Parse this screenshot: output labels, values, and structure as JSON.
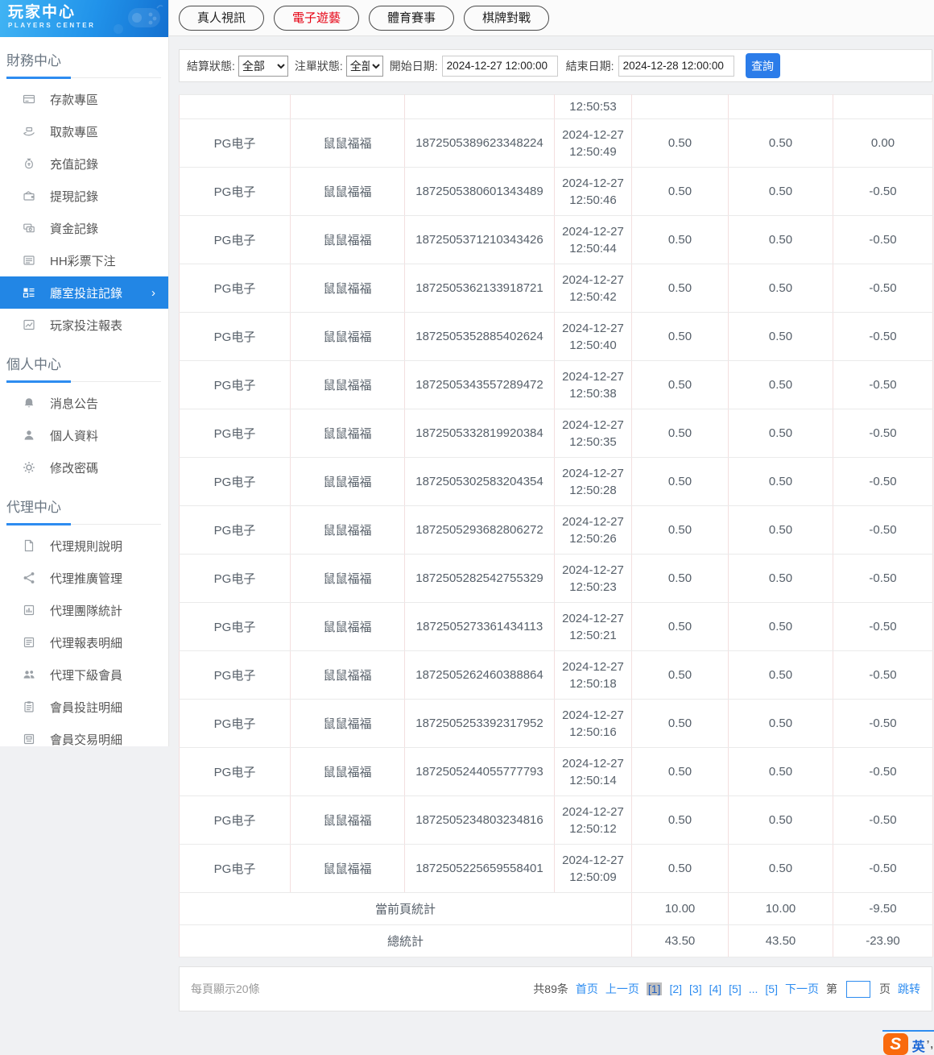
{
  "sidebar": {
    "logo": {
      "title": "玩家中心",
      "subtitle": "PLAYERS CENTER"
    },
    "sections": [
      {
        "title": "財務中心",
        "items": [
          {
            "slug": "deposit-area",
            "icon": "deposit-icon",
            "label": "存款專區"
          },
          {
            "slug": "withdraw-area",
            "icon": "withdraw-icon",
            "label": "取款專區"
          },
          {
            "slug": "recharge-records",
            "icon": "recharge-icon",
            "label": "充值記錄"
          },
          {
            "slug": "withdrawal-records",
            "icon": "wallet-icon",
            "label": "提現記錄"
          },
          {
            "slug": "funds-records",
            "icon": "funds-icon",
            "label": "資金記錄"
          },
          {
            "slug": "hh-lottery-bets",
            "icon": "lottery-icon",
            "label": "HH彩票下注"
          },
          {
            "slug": "room-bet-records",
            "icon": "room-bets-icon",
            "label": "廳室投註記錄",
            "active": true,
            "chevron": "›"
          },
          {
            "slug": "player-bet-report",
            "icon": "chart-icon",
            "label": "玩家投注報表"
          }
        ]
      },
      {
        "title": "個人中心",
        "items": [
          {
            "slug": "announcements",
            "icon": "bell-icon",
            "label": "消息公告"
          },
          {
            "slug": "profile",
            "icon": "person-icon",
            "label": "個人資料"
          },
          {
            "slug": "change-password",
            "icon": "gear-icon",
            "label": "修改密碼"
          }
        ]
      },
      {
        "title": "代理中心",
        "items": [
          {
            "slug": "agent-rules",
            "icon": "doc-icon",
            "label": "代理規則說明"
          },
          {
            "slug": "agent-promotion",
            "icon": "share-icon",
            "label": "代理推廣管理"
          },
          {
            "slug": "agent-team-stats",
            "icon": "team-stats-icon",
            "label": "代理團隊統計"
          },
          {
            "slug": "agent-report-detail",
            "icon": "report-detail-icon",
            "label": "代理報表明細"
          },
          {
            "slug": "agent-sub-members",
            "icon": "users-icon",
            "label": "代理下級會員"
          },
          {
            "slug": "member-bet-detail",
            "icon": "clipboard-icon",
            "label": "會員投註明細"
          },
          {
            "slug": "member-transaction-detail",
            "icon": "ledger-icon",
            "label": "會員交易明細"
          }
        ]
      }
    ]
  },
  "tabs": [
    {
      "slug": "live-video",
      "label": "真人視訊",
      "active": false
    },
    {
      "slug": "electronic-games",
      "label": "電子遊藝",
      "active": true
    },
    {
      "slug": "sports",
      "label": "體育賽事",
      "active": false
    },
    {
      "slug": "board-games",
      "label": "棋牌對戰",
      "active": false
    }
  ],
  "filters": {
    "settle_status_label": "結算狀態:",
    "settle_status_value": "全部",
    "order_status_label": "注單狀態:",
    "order_status_value": "全部",
    "start_date_label": "開始日期:",
    "start_date_value": "2024-12-27 12:00:00",
    "end_date_label": "結束日期:",
    "end_date_value": "2024-12-28 12:00:00",
    "search_button": "查詢"
  },
  "table": {
    "rows": [
      {
        "partial": true,
        "platform": "",
        "player": "",
        "order": "",
        "date": "",
        "time": "12:50:53",
        "bet": "",
        "valid": "",
        "profit": ""
      },
      {
        "platform": "PG电子",
        "player": "鼠鼠福福",
        "order": "1872505389623348224",
        "date": "2024-12-27",
        "time": "12:50:49",
        "bet": "0.50",
        "valid": "0.50",
        "profit": "0.00"
      },
      {
        "platform": "PG电子",
        "player": "鼠鼠福福",
        "order": "1872505380601343489",
        "date": "2024-12-27",
        "time": "12:50:46",
        "bet": "0.50",
        "valid": "0.50",
        "profit": "-0.50"
      },
      {
        "platform": "PG电子",
        "player": "鼠鼠福福",
        "order": "1872505371210343426",
        "date": "2024-12-27",
        "time": "12:50:44",
        "bet": "0.50",
        "valid": "0.50",
        "profit": "-0.50"
      },
      {
        "platform": "PG电子",
        "player": "鼠鼠福福",
        "order": "1872505362133918721",
        "date": "2024-12-27",
        "time": "12:50:42",
        "bet": "0.50",
        "valid": "0.50",
        "profit": "-0.50"
      },
      {
        "platform": "PG电子",
        "player": "鼠鼠福福",
        "order": "1872505352885402624",
        "date": "2024-12-27",
        "time": "12:50:40",
        "bet": "0.50",
        "valid": "0.50",
        "profit": "-0.50"
      },
      {
        "platform": "PG电子",
        "player": "鼠鼠福福",
        "order": "1872505343557289472",
        "date": "2024-12-27",
        "time": "12:50:38",
        "bet": "0.50",
        "valid": "0.50",
        "profit": "-0.50"
      },
      {
        "platform": "PG电子",
        "player": "鼠鼠福福",
        "order": "1872505332819920384",
        "date": "2024-12-27",
        "time": "12:50:35",
        "bet": "0.50",
        "valid": "0.50",
        "profit": "-0.50"
      },
      {
        "platform": "PG电子",
        "player": "鼠鼠福福",
        "order": "1872505302583204354",
        "date": "2024-12-27",
        "time": "12:50:28",
        "bet": "0.50",
        "valid": "0.50",
        "profit": "-0.50"
      },
      {
        "platform": "PG电子",
        "player": "鼠鼠福福",
        "order": "1872505293682806272",
        "date": "2024-12-27",
        "time": "12:50:26",
        "bet": "0.50",
        "valid": "0.50",
        "profit": "-0.50"
      },
      {
        "platform": "PG电子",
        "player": "鼠鼠福福",
        "order": "1872505282542755329",
        "date": "2024-12-27",
        "time": "12:50:23",
        "bet": "0.50",
        "valid": "0.50",
        "profit": "-0.50"
      },
      {
        "platform": "PG电子",
        "player": "鼠鼠福福",
        "order": "1872505273361434113",
        "date": "2024-12-27",
        "time": "12:50:21",
        "bet": "0.50",
        "valid": "0.50",
        "profit": "-0.50"
      },
      {
        "platform": "PG电子",
        "player": "鼠鼠福福",
        "order": "1872505262460388864",
        "date": "2024-12-27",
        "time": "12:50:18",
        "bet": "0.50",
        "valid": "0.50",
        "profit": "-0.50"
      },
      {
        "platform": "PG电子",
        "player": "鼠鼠福福",
        "order": "1872505253392317952",
        "date": "2024-12-27",
        "time": "12:50:16",
        "bet": "0.50",
        "valid": "0.50",
        "profit": "-0.50"
      },
      {
        "platform": "PG电子",
        "player": "鼠鼠福福",
        "order": "1872505244055777793",
        "date": "2024-12-27",
        "time": "12:50:14",
        "bet": "0.50",
        "valid": "0.50",
        "profit": "-0.50"
      },
      {
        "platform": "PG电子",
        "player": "鼠鼠福福",
        "order": "1872505234803234816",
        "date": "2024-12-27",
        "time": "12:50:12",
        "bet": "0.50",
        "valid": "0.50",
        "profit": "-0.50"
      },
      {
        "platform": "PG电子",
        "player": "鼠鼠福福",
        "order": "1872505225659558401",
        "date": "2024-12-27",
        "time": "12:50:09",
        "bet": "0.50",
        "valid": "0.50",
        "profit": "-0.50"
      }
    ],
    "summary": [
      {
        "label": "當前頁統計",
        "bet": "10.00",
        "valid": "10.00",
        "profit": "-9.50"
      },
      {
        "label": "總統計",
        "bet": "43.50",
        "valid": "43.50",
        "profit": "-23.90"
      }
    ]
  },
  "pagination": {
    "page_size_text": "每頁顯示20條",
    "total_text": "共89条",
    "first_label": "首页",
    "prev_label": "上一页",
    "pages": [
      "[1]",
      "[2]",
      "[3]",
      "[4]",
      "[5]",
      "...",
      "[5]"
    ],
    "current_index": 0,
    "next_label": "下一页",
    "jump_prefix": "第",
    "jump_suffix": "页",
    "jump_label": "跳转"
  },
  "ime_widget": {
    "logo_letter": "S",
    "lang_text": "英",
    "marks": "’,"
  },
  "colors": {
    "accent_blue": "#2286e5",
    "active_tab_red": "#e60012",
    "link_blue": "#2d8cf0",
    "table_border_v": "#f3dfdf",
    "table_border_h": "#eaeaea"
  }
}
